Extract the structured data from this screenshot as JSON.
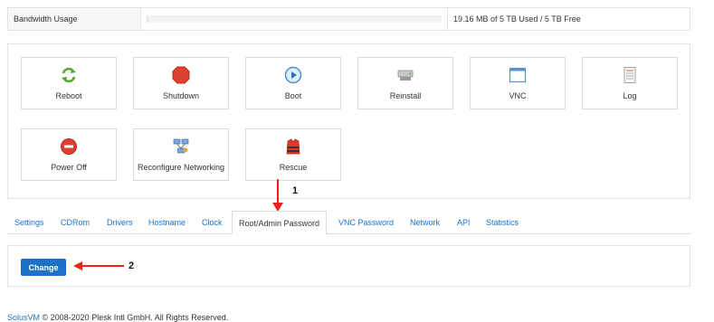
{
  "bandwidth": {
    "label": "Bandwidth Usage",
    "used_fraction": 0.004,
    "text": "19.16 MB of 5 TB Used / 5 TB Free"
  },
  "actions": [
    {
      "label": "Reboot",
      "icon": "refresh-arrows-icon"
    },
    {
      "label": "Shutdown",
      "icon": "stop-octagon-icon"
    },
    {
      "label": "Boot",
      "icon": "play-circle-icon"
    },
    {
      "label": "Reinstall",
      "icon": "drive-icon"
    },
    {
      "label": "VNC",
      "icon": "window-icon"
    },
    {
      "label": "Log",
      "icon": "notepad-icon"
    },
    {
      "label": "Power Off",
      "icon": "no-entry-icon"
    },
    {
      "label": "Reconfigure Networking",
      "icon": "network-icon"
    },
    {
      "label": "Rescue",
      "icon": "life-vest-icon"
    }
  ],
  "tabs": [
    {
      "label": "Settings",
      "active": false
    },
    {
      "label": "CDRom",
      "active": false
    },
    {
      "label": "Drivers",
      "active": false
    },
    {
      "label": "Hostname",
      "active": false
    },
    {
      "label": "Clock",
      "active": false
    },
    {
      "label": "Root/Admin Password",
      "active": true
    },
    {
      "label": "VNC Password",
      "active": false
    },
    {
      "label": "Network",
      "active": false
    },
    {
      "label": "API",
      "active": false
    },
    {
      "label": "Statistics",
      "active": false
    }
  ],
  "change_button": "Change",
  "annotations": {
    "one": "1",
    "two": "2"
  },
  "footer": {
    "link": "SolusVM",
    "text": " © 2008-2020 Plesk Intl GmbH. All Rights Reserved."
  },
  "colors": {
    "accent": "#1a73c8",
    "annotation_arrow": "#e8231b"
  }
}
